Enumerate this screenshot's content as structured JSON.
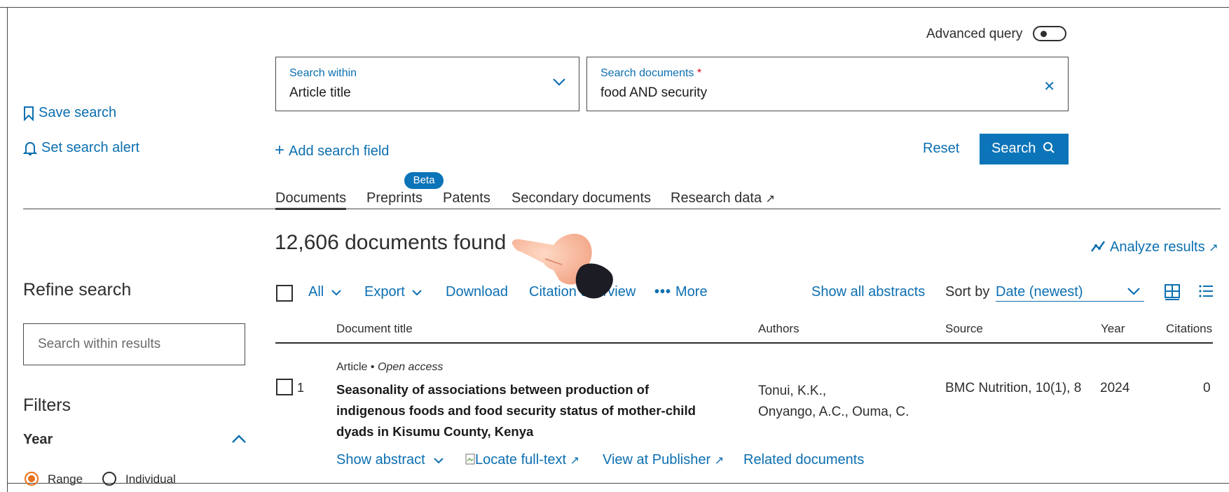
{
  "advanced_query": {
    "label": "Advanced query"
  },
  "search_within": {
    "label": "Search within",
    "value": "Article title"
  },
  "search_documents": {
    "label": "Search documents",
    "required_mark": "*",
    "value": "food AND security"
  },
  "left_actions": {
    "save_search": "Save search",
    "set_alert": "Set search alert"
  },
  "add_search_field": "Add search field",
  "reset": "Reset",
  "search_button": "Search",
  "tabs": [
    {
      "label": "Documents",
      "active": true
    },
    {
      "label": "Preprints",
      "badge": "Beta"
    },
    {
      "label": "Patents"
    },
    {
      "label": "Secondary documents"
    },
    {
      "label": "Research data",
      "external": "↗"
    }
  ],
  "results_count": "12,606 documents found",
  "analyze_results": "Analyze results",
  "external_arrow": "↗",
  "refine": {
    "title": "Refine search",
    "search_placeholder": "Search within results",
    "filters_title": "Filters",
    "year_title": "Year",
    "range_label": "Range",
    "individual_label": "Individual"
  },
  "toolbar": {
    "all": "All",
    "export": "Export",
    "download": "Download",
    "citation_overview": "Citation overview",
    "more": "More",
    "show_all_abstracts": "Show all abstracts",
    "sort_by_label": "Sort by",
    "sort_by_value": "Date (newest)"
  },
  "columns": {
    "document_title": "Document title",
    "authors": "Authors",
    "source": "Source",
    "year": "Year",
    "citations": "Citations"
  },
  "results": [
    {
      "number": "1",
      "type": "Article",
      "separator": "•",
      "access": "Open access",
      "title": "Seasonality of associations between production of indigenous foods and food security status of mother-child dyads in Kisumu County, Kenya",
      "authors_line1": "Tonui, K.K.,",
      "authors_line2": "Onyango, A.C., Ouma, C.",
      "source": "BMC Nutrition, 10(1), 8",
      "year": "2024",
      "citations": "0",
      "actions": {
        "show_abstract": "Show abstract",
        "locate_full_text": "Locate full-text",
        "view_at_publisher": "View at Publisher",
        "related_documents": "Related documents"
      }
    }
  ],
  "colors": {
    "link": "#0c6fb1",
    "primary": "#0c74b8",
    "radio_active": "#e9711c"
  }
}
